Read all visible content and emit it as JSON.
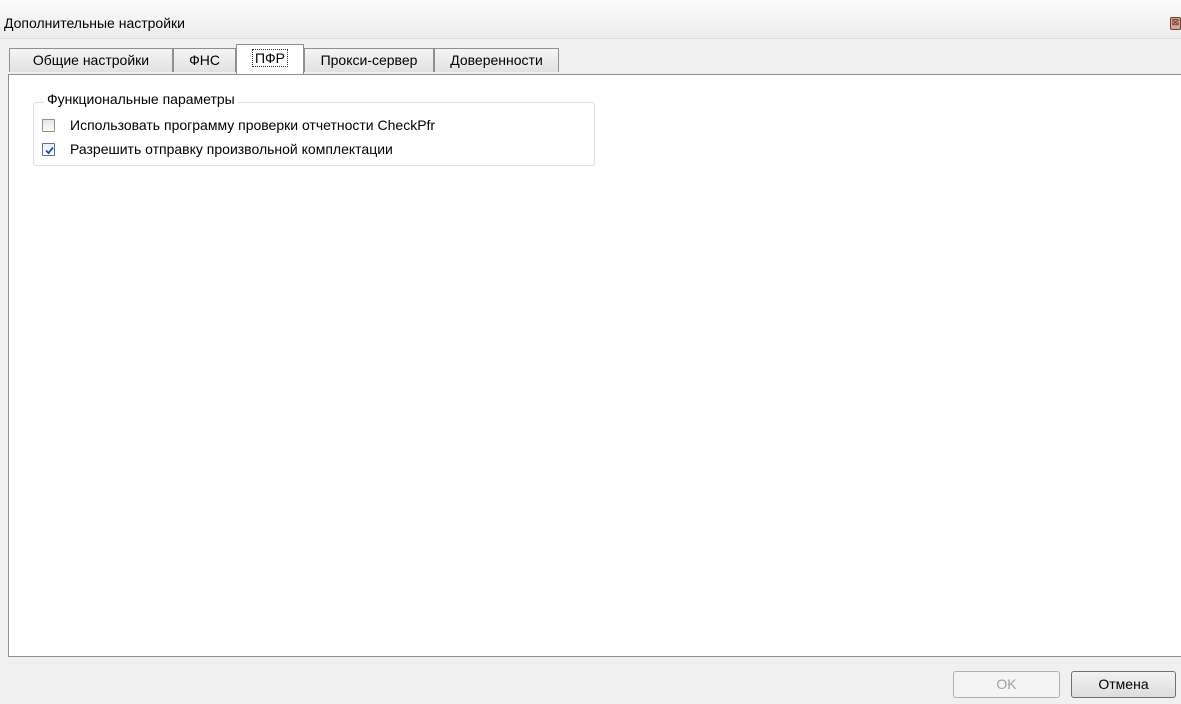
{
  "window": {
    "title": "Дополнительные настройки",
    "close_glyph": "⊠"
  },
  "tabs": [
    {
      "label": "Общие настройки",
      "active": false
    },
    {
      "label": "ФНС",
      "active": false
    },
    {
      "label": "ПФР",
      "active": true
    },
    {
      "label": "Прокси-сервер",
      "active": false
    },
    {
      "label": "Доверенности",
      "active": false
    }
  ],
  "group": {
    "title": "Функциональные параметры",
    "options": [
      {
        "label": "Использовать программу проверки отчетности  CheckPfr",
        "checked": false
      },
      {
        "label": "Разрешить отправку произвольной комплектации",
        "checked": true
      }
    ]
  },
  "buttons": {
    "ok": {
      "label": "OK",
      "enabled": false
    },
    "cancel": {
      "label": "Отмена",
      "enabled": true
    }
  },
  "colors": {
    "accent": "#2a4fa0",
    "window_bg": "#f0f0f0",
    "panel_bg": "#ffffff"
  }
}
